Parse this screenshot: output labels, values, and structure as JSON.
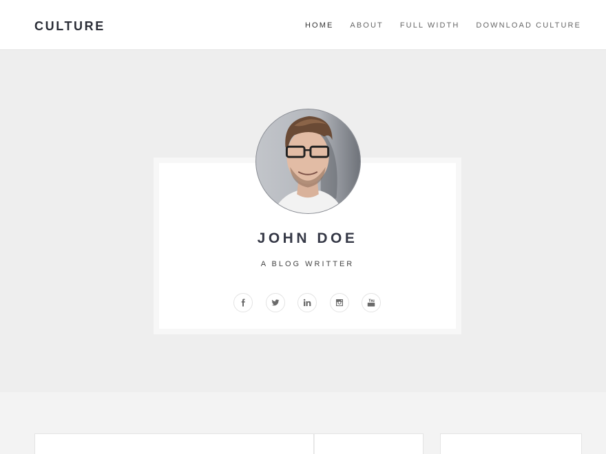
{
  "site": {
    "logo": "CULTURE"
  },
  "nav": {
    "items": [
      {
        "label": "HOME",
        "active": true
      },
      {
        "label": "ABOUT",
        "active": false
      },
      {
        "label": "FULL WIDTH",
        "active": false
      },
      {
        "label": "DOWNLOAD CULTURE",
        "active": false
      }
    ]
  },
  "profile": {
    "avatar_alt": "John Doe profile photo",
    "name": "JOHN DOE",
    "tagline": "A BLOG WRITTER",
    "socials": [
      {
        "network": "facebook",
        "icon": "facebook-icon"
      },
      {
        "network": "twitter",
        "icon": "twitter-icon"
      },
      {
        "network": "linkedin",
        "icon": "linkedin-icon"
      },
      {
        "network": "instagram",
        "icon": "instagram-icon"
      },
      {
        "network": "youtube",
        "icon": "youtube-icon"
      }
    ]
  },
  "colors": {
    "header_bg": "#ffffff",
    "hero_bg": "#eeeeee",
    "content_bg": "#f3f3f3",
    "card_border": "#f7f7f7",
    "text_dark": "#353846"
  }
}
